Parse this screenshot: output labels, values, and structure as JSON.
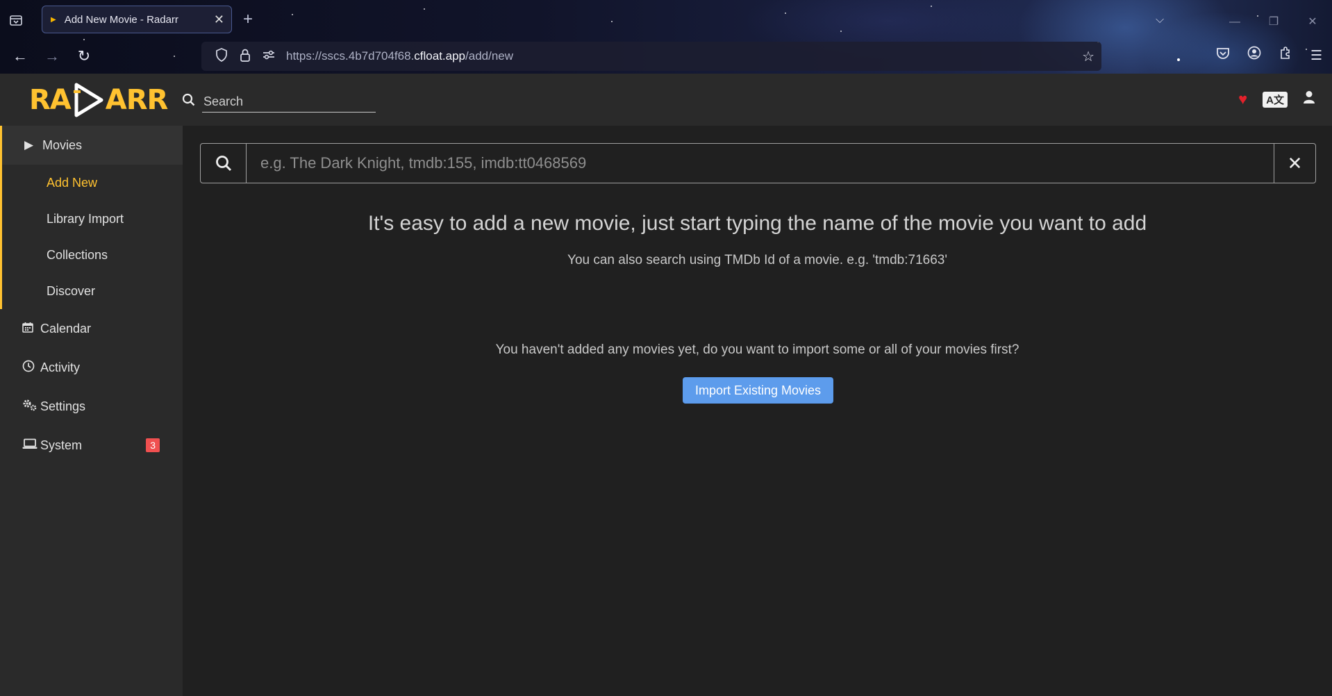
{
  "browser": {
    "tab_title": "Add New Movie - Radarr",
    "url_prefix": "https://sscs.4b7d704f68.",
    "url_domain": "cfloat.app",
    "url_path": "/add/new"
  },
  "header": {
    "logo_left": "RA",
    "logo_right": "ARR",
    "search_placeholder": "Search",
    "lang_badge": "A文"
  },
  "sidebar": {
    "movies": {
      "label": "Movies",
      "icon": "play-icon"
    },
    "sub_items": [
      {
        "label": "Add New",
        "current": true
      },
      {
        "label": "Library Import"
      },
      {
        "label": "Collections"
      },
      {
        "label": "Discover"
      }
    ],
    "calendar": {
      "label": "Calendar",
      "icon": "calendar-icon"
    },
    "activity": {
      "label": "Activity",
      "icon": "clock-icon"
    },
    "settings": {
      "label": "Settings",
      "icon": "cogs-icon"
    },
    "system": {
      "label": "System",
      "icon": "laptop-icon",
      "badge": "3"
    }
  },
  "main": {
    "search_placeholder": "e.g. The Dark Knight, tmdb:155, imdb:tt0468569",
    "help_title": "It's easy to add a new movie, just start typing the name of the movie you want to add",
    "help_sub": "You can also search using TMDb Id of a movie. e.g. 'tmdb:71663'",
    "no_movies_text": "You haven't added any movies yet, do you want to import some or all of your movies first?",
    "import_button": "Import Existing Movies"
  },
  "colors": {
    "accent": "#ffc230",
    "primary_button": "#5d9cec",
    "badge": "#f05050",
    "sidebar_bg": "#2a2a2a",
    "page_bg": "#202020"
  }
}
